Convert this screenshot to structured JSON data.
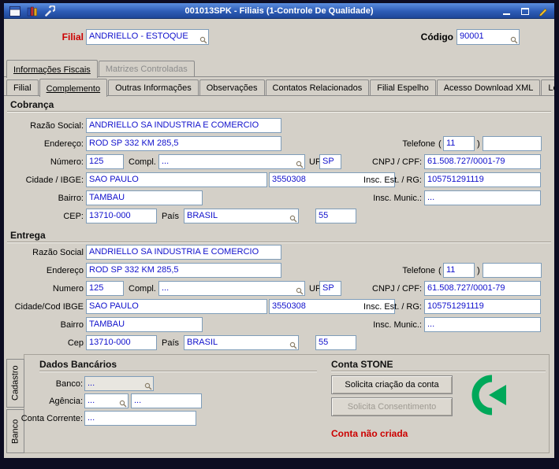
{
  "titlebar": {
    "title": "001013SPK - Filiais (1-Controle De Qualidade)"
  },
  "header": {
    "filial": {
      "label": "Filial",
      "value": "ANDRIELLO - ESTOQUE"
    },
    "codigo": {
      "label": "Código",
      "value": "90001"
    }
  },
  "outer_tabs": [
    {
      "label": "Informações Fiscais",
      "active": true
    },
    {
      "label": "Matrizes Controladas",
      "active": false
    }
  ],
  "inner_tabs": [
    {
      "label": "Filial",
      "active": false
    },
    {
      "label": "Complemento",
      "active": true
    },
    {
      "label": "Outras Informações",
      "active": false
    },
    {
      "label": "Observações",
      "active": false
    },
    {
      "label": "Contatos Relacionados",
      "active": false
    },
    {
      "label": "Filial Espelho",
      "active": false
    },
    {
      "label": "Acesso Download XML",
      "active": false
    },
    {
      "label": "Log",
      "active": false
    }
  ],
  "cobranca": {
    "title": "Cobrança",
    "razao_social": {
      "label": "Razão Social:",
      "value": "ANDRIELLO SA INDUSTRIA E COMERCIO"
    },
    "endereco": {
      "label": "Endereço:",
      "value": "ROD SP 332 KM 285,5"
    },
    "numero": {
      "label": "Número:",
      "value": "125"
    },
    "compl": {
      "label": "Compl.",
      "value": "..."
    },
    "uf": {
      "label": "UF",
      "value": "SP"
    },
    "cidade": {
      "label": "Cidade / IBGE:",
      "value": "SAO PAULO",
      "ibge": "3550308"
    },
    "bairro": {
      "label": "Bairro:",
      "value": "TAMBAU"
    },
    "cep": {
      "label": "CEP:",
      "value": "13710-000"
    },
    "pais": {
      "label": "País",
      "value": "BRASIL",
      "code": "55"
    },
    "telefone": {
      "label": "Telefone",
      "open": "(",
      "ddd": "11",
      "close": ")",
      "numero": ""
    },
    "cnpj": {
      "label": "CNPJ / CPF:",
      "value": "61.508.727/0001-79"
    },
    "insc_est": {
      "label": "Insc. Est. / RG:",
      "value": "105751291119"
    },
    "insc_mun": {
      "label": "Insc. Munic.:",
      "value": "..."
    }
  },
  "entrega": {
    "title": "Entrega",
    "razao_social": {
      "label": "Razão Social",
      "value": "ANDRIELLO SA INDUSTRIA E COMERCIO"
    },
    "endereco": {
      "label": "Endereço",
      "value": "ROD SP 332 KM 285,5"
    },
    "numero": {
      "label": "Numero",
      "value": "125"
    },
    "compl": {
      "label": "Compl.",
      "value": "..."
    },
    "uf": {
      "label": "UF",
      "value": "SP"
    },
    "cidade": {
      "label": "Cidade/Cod IBGE",
      "value": "SAO PAULO",
      "ibge": "3550308"
    },
    "bairro": {
      "label": "Bairro",
      "value": "TAMBAU"
    },
    "cep": {
      "label": "Cep",
      "value": "13710-000"
    },
    "pais": {
      "label": "País",
      "value": "BRASIL",
      "code": "55"
    },
    "telefone": {
      "label": "Telefone",
      "open": "(",
      "ddd": "11",
      "close": ")",
      "numero": ""
    },
    "cnpj": {
      "label": "CNPJ / CPF:",
      "value": "61.508.727/0001-79"
    },
    "insc_est": {
      "label": "Insc. Est. / RG:",
      "value": "105751291119"
    },
    "insc_mun": {
      "label": "Insc. Munic.:",
      "value": "..."
    }
  },
  "side_tabs": [
    {
      "label": "Cadastro",
      "active": false
    },
    {
      "label": "Banco",
      "active": true
    }
  ],
  "dados_bancarios": {
    "title": "Dados Bancários",
    "banco": {
      "label": "Banco:",
      "value": "..."
    },
    "agencia": {
      "label": "Agência:",
      "value": "...",
      "value2": "..."
    },
    "conta_corrente": {
      "label": "Conta Corrente:",
      "value": "..."
    }
  },
  "conta_stone": {
    "title": "Conta STONE",
    "solicita_criacao": "Solicita criação da conta",
    "solicita_consentimento": "Solicita Consentimento",
    "status": "Conta não criada"
  },
  "colors": {
    "titlebar_blue": "#2d5cb6",
    "field_text_blue": "#1010cc",
    "filial_label_red": "#cc0000",
    "status_red": "#cc0000",
    "stone_green": "#00a85a"
  },
  "icons": {
    "titlebar_left": [
      "form-icon",
      "books-icon",
      "wrench-icon"
    ],
    "titlebar_right": [
      "minimize-icon",
      "maximize-icon",
      "edit-pencil-icon"
    ],
    "field_lookup": "magnifier-icon",
    "stone_logo": "stone-logo-icon"
  }
}
